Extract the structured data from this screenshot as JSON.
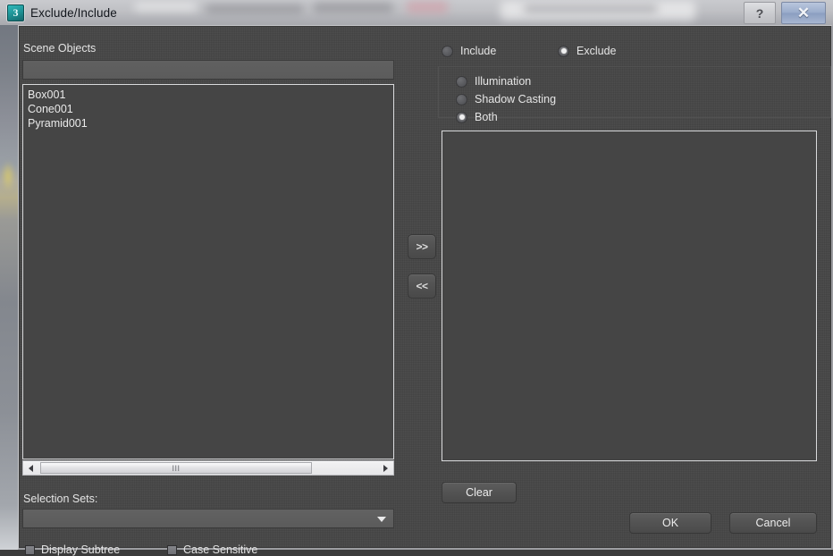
{
  "window": {
    "title": "Exclude/Include",
    "app_icon": "3",
    "app_icon_name": "3ds-max-icon",
    "help_label": "?",
    "close_label": "✕"
  },
  "left_pane": {
    "scene_objects_label": "Scene Objects",
    "filter_value": "",
    "filter_placeholder": "",
    "items": [
      "Box001",
      "Cone001",
      "Pyramid001"
    ],
    "scrollbar": {
      "left_arrow": "◀",
      "right_arrow": "▶",
      "grip": "III"
    },
    "selection_sets_label": "Selection Sets:",
    "selection_sets_value": "",
    "checkboxes": [
      {
        "label": "Display Subtree",
        "checked": false
      },
      {
        "label": "Case Sensitive",
        "checked": false
      }
    ]
  },
  "transfer": {
    "add_label": ">>",
    "remove_label": "<<"
  },
  "right_pane": {
    "mode_radios": [
      {
        "label": "Include",
        "selected": false
      },
      {
        "label": "Exclude",
        "selected": true
      }
    ],
    "effect_radios": [
      {
        "label": "Illumination",
        "selected": false
      },
      {
        "label": "Shadow Casting",
        "selected": false
      },
      {
        "label": "Both",
        "selected": true
      }
    ],
    "target_items": [],
    "clear_label": "Clear"
  },
  "footer": {
    "ok_label": "OK",
    "cancel_label": "Cancel"
  },
  "colors": {
    "dialog_bg": "#464646",
    "field_bg": "#5c5c5c",
    "text": "#e4e4e4",
    "list_border": "#d9dadc",
    "titlebar": "#bfc0c4",
    "close_accent": "#9aaccb",
    "icon_teal": "#1d8f92"
  }
}
